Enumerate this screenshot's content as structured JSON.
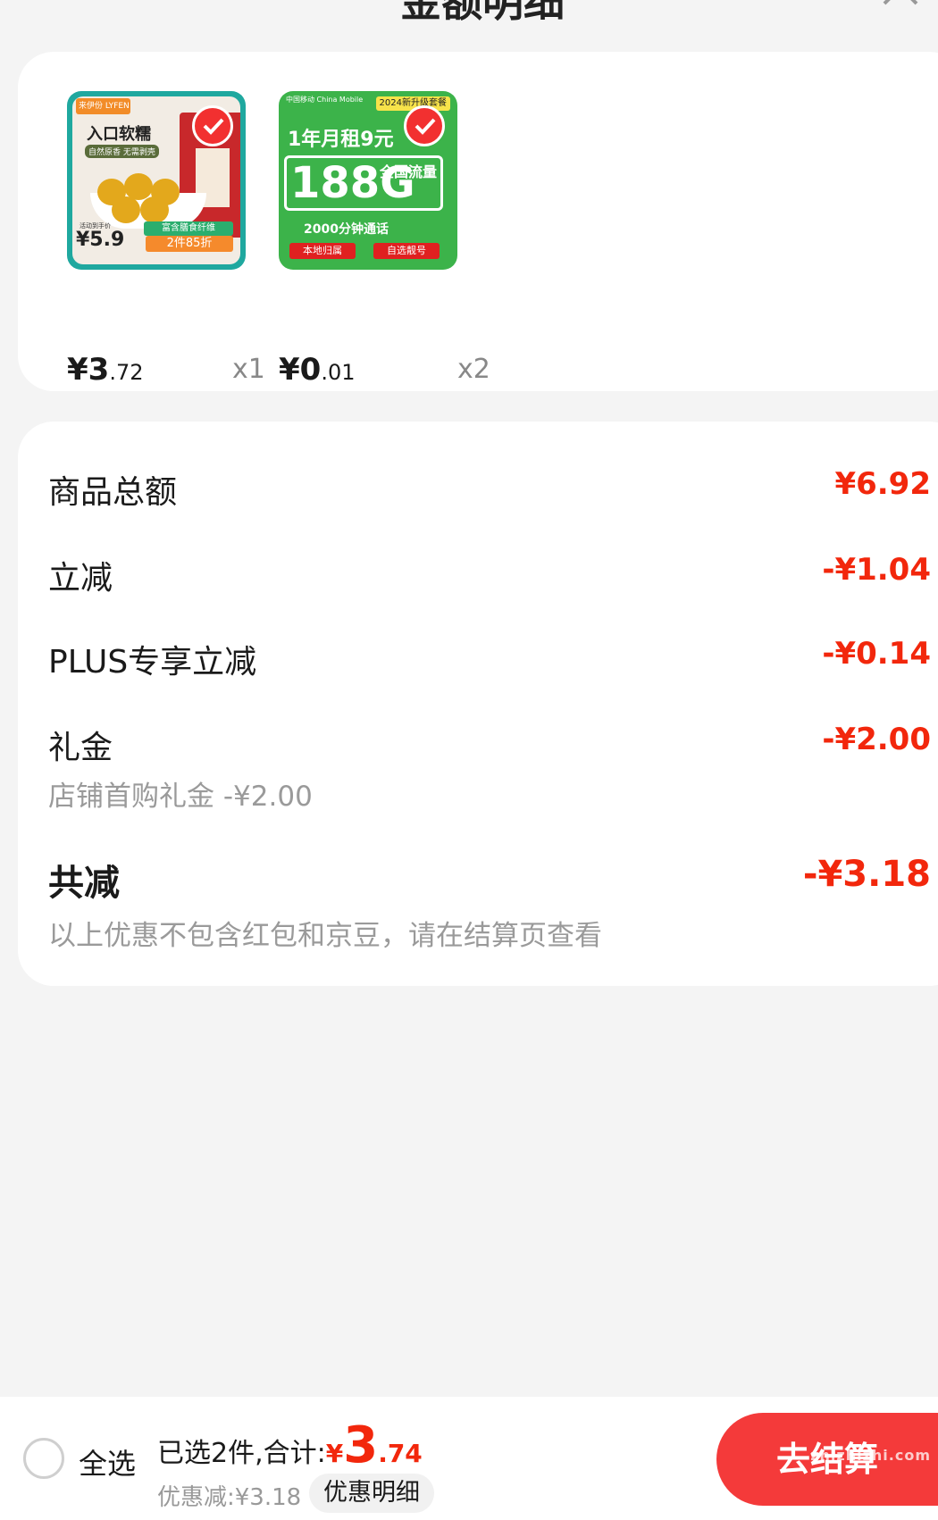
{
  "header": {
    "title": "金额明细"
  },
  "products": [
    {
      "price_int": "¥3",
      "price_dec": ".72",
      "qty": "x1",
      "image_text": {
        "brand": "来伊份 LYFEN",
        "title": "入口软糯",
        "sub": "自然原香 无需剥壳",
        "band": "富含膳食纤维",
        "band2": "2件85折",
        "tag_small": "活动到手价",
        "tag": "¥5.9"
      }
    },
    {
      "price_int": "¥0",
      "price_dec": ".01",
      "qty": "x2",
      "image_text": {
        "carrier": "中国移动 China Mobile",
        "corner": "2024新升级套餐",
        "rent": "1年月租9元",
        "big": "188G",
        "side": "全国流量",
        "mins": "2000分钟通话",
        "red1": "本地归属",
        "red2": "自选靓号"
      }
    }
  ],
  "details": {
    "total_label": "商品总额",
    "total_value": "¥6.92",
    "instant_label": "立减",
    "instant_value": "-¥1.04",
    "plus_label": "PLUS专享立减",
    "plus_value": "-¥0.14",
    "gift_label": "礼金",
    "gift_value": "-¥2.00",
    "gift_note": "店铺首购礼金 -¥2.00",
    "sum_label": "共减",
    "sum_value": "-¥3.18",
    "sum_note": "以上优惠不包含红包和京豆，请在结算页查看"
  },
  "bottom": {
    "select_all": "全选",
    "selected_text": "已选2件,合计:",
    "currency": "¥",
    "total_int": "3",
    "total_dec": ".74",
    "discount_text": "优惠减:¥3.18",
    "detail_button": "优惠明细",
    "checkout_button": "去结算",
    "watermark": "zhizhizhi.com"
  },
  "colors": {
    "accent": "#f2270c",
    "checkout": "#f43a3a",
    "background": "#f4f4f4"
  }
}
